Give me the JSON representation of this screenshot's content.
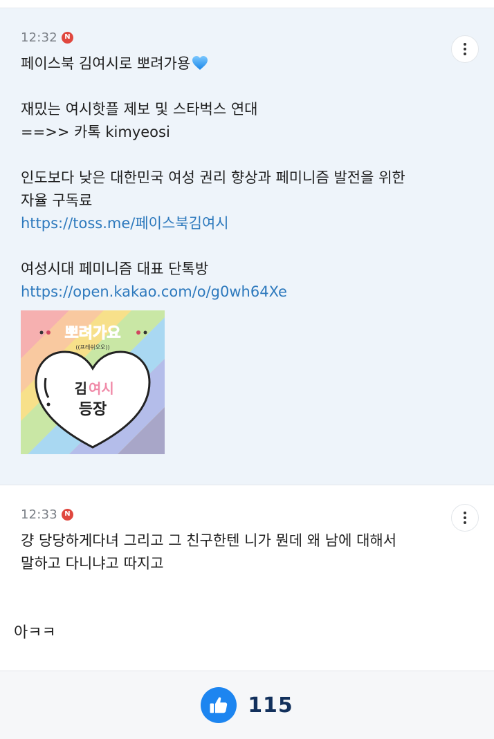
{
  "post": {
    "time": "12:32",
    "badge": "N",
    "lines": [
      "페이스북 김여시로 뽀려가용",
      "",
      "재밌는 여시핫플 제보 및 스타벅스 연대",
      "==>> 카톡 kimyeosi",
      "",
      "인도보다 낮은 대한민국 여성 권리 향상과 페미니즘 발전을 위한",
      "자율 구독료"
    ],
    "link1": "https://toss.me/페이스북김여시",
    "line_after_link": "여성시대 페미니즘 대표 단톡방",
    "link2": "https://open.kakao.com/o/g0wh64Xe",
    "heart_icon": "blue-heart-emoji",
    "sticker": {
      "top_text": "뽀려가요",
      "sub_text": "((프레쉬오오))",
      "heart_line1_a": "김",
      "heart_line1_b": "여시",
      "heart_line2": "등장"
    }
  },
  "reply": {
    "time": "12:33",
    "badge": "N",
    "line1": "걍 당당하게다녀 그리고 그 친구한텐 니가 뭔데 왜 남에 대해서",
    "line2": "말하고 다니냐고 따지고"
  },
  "standalone_text": "아ㅋㅋ",
  "likes": {
    "count": "115",
    "icon": "thumbs-up-icon"
  },
  "colors": {
    "accent_blue": "#1d85f0",
    "link": "#2d79bd",
    "post_bg": "#eef4fa",
    "badge_red": "#e0473e",
    "count_navy": "#12305c"
  }
}
